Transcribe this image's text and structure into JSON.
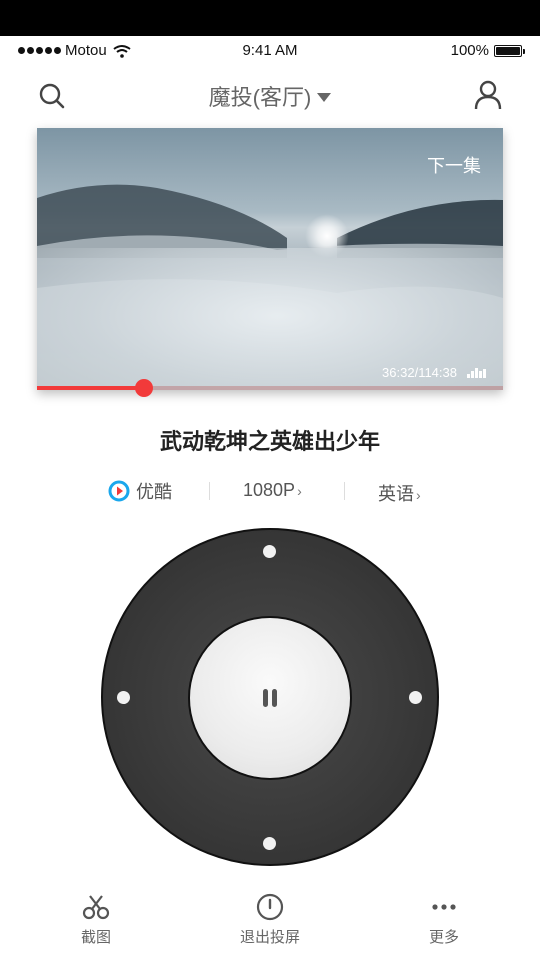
{
  "status_bar": {
    "carrier": "Motou",
    "time": "9:41 AM",
    "battery": "100%"
  },
  "nav": {
    "title": "魔投(客厅)"
  },
  "video": {
    "next_episode": "下一集",
    "time_readout": "36:32/114:38",
    "progress": 0.23
  },
  "show_title": "武动乾坤之英雄出少年",
  "info": {
    "source": "优酷",
    "quality": "1080P",
    "audio_language": "英语"
  },
  "colors": {
    "accent": "#f23a3a",
    "dpad": "#3a3a3a",
    "background": "#ffffff",
    "youku_blue": "#1aa7ec"
  },
  "tabs": [
    {
      "label": "截图",
      "icon": "scissors-icon"
    },
    {
      "label": "退出投屏",
      "icon": "power-icon"
    },
    {
      "label": "更多",
      "icon": "more-dots-icon"
    }
  ]
}
